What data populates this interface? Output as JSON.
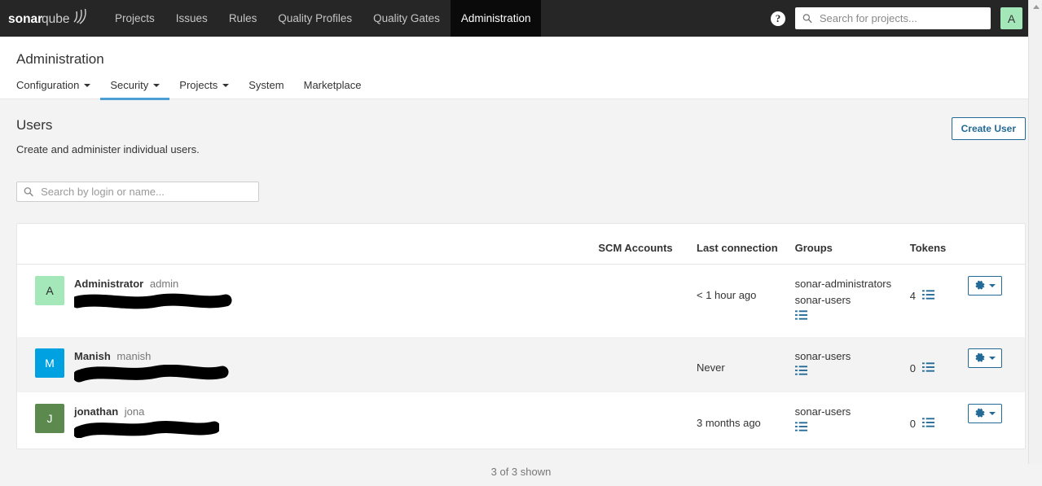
{
  "navbar": {
    "brand": "sonarqube",
    "links": [
      {
        "label": "Projects",
        "active": false
      },
      {
        "label": "Issues",
        "active": false
      },
      {
        "label": "Rules",
        "active": false
      },
      {
        "label": "Quality Profiles",
        "active": false
      },
      {
        "label": "Quality Gates",
        "active": false
      },
      {
        "label": "Administration",
        "active": true
      }
    ],
    "help_label": "?",
    "search_placeholder": "Search for projects...",
    "search_value": "",
    "avatar_letter": "A",
    "avatar_color": "#a4e8b9"
  },
  "page": {
    "title": "Administration",
    "subnav": [
      {
        "label": "Configuration",
        "caret": true,
        "active": false
      },
      {
        "label": "Security",
        "caret": true,
        "active": true
      },
      {
        "label": "Projects",
        "caret": true,
        "active": false
      },
      {
        "label": "System",
        "caret": false,
        "active": false
      },
      {
        "label": "Marketplace",
        "caret": false,
        "active": false
      }
    ],
    "accent_color": "#4b9fd5"
  },
  "section": {
    "title": "Users",
    "description": "Create and administer individual users.",
    "create_button": "Create User",
    "search_placeholder": "Search by login or name...",
    "search_value": ""
  },
  "table": {
    "headers": {
      "user": "",
      "scm": "SCM Accounts",
      "last_connection": "Last connection",
      "groups": "Groups",
      "tokens": "Tokens",
      "actions": ""
    },
    "rows": [
      {
        "avatar_letter": "A",
        "avatar_color": "#a4e8b9",
        "avatar_text_color": "#2b2b2b",
        "name": "Administrator",
        "login": "admin",
        "email": "",
        "email_redacted": true,
        "scm": "",
        "last_connection": "< 1 hour ago",
        "groups": [
          "sonar-administrators",
          "sonar-users"
        ],
        "tokens": "4",
        "alt": false
      },
      {
        "avatar_letter": "M",
        "avatar_color": "#00a1e0",
        "avatar_text_color": "#ffffff",
        "name": "Manish",
        "login": "manish",
        "email": "",
        "email_redacted": true,
        "scm": "",
        "last_connection": "Never",
        "groups": [
          "sonar-users"
        ],
        "tokens": "0",
        "alt": true
      },
      {
        "avatar_letter": "J",
        "avatar_color": "#5c8a4e",
        "avatar_text_color": "#ffffff",
        "name": "jonathan",
        "login": "jona",
        "email": "",
        "email_redacted": true,
        "scm": "",
        "last_connection": "3 months ago",
        "groups": [
          "sonar-users"
        ],
        "tokens": "0",
        "alt": false
      }
    ],
    "footer_count": "3 of 3 shown"
  }
}
